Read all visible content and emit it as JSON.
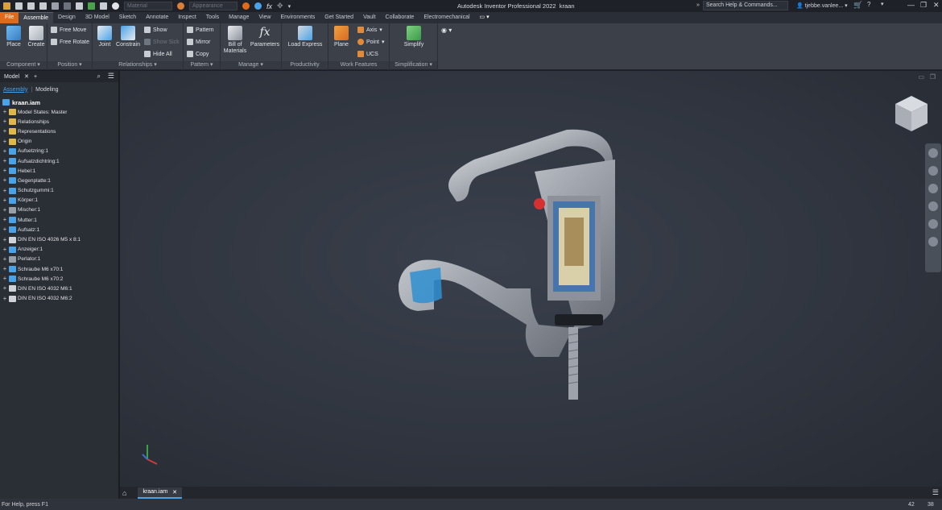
{
  "app": {
    "title": "Autodesk Inventor Professional 2022",
    "document": "kraan",
    "material_placeholder": "Material",
    "appearance_placeholder": "Appearance",
    "search_label": "Search Help & Commands...",
    "user": "tjebbe.vanlee..."
  },
  "tabs": [
    "File",
    "Assemble",
    "Design",
    "3D Model",
    "Sketch",
    "Annotate",
    "Inspect",
    "Tools",
    "Manage",
    "View",
    "Environments",
    "Get Started",
    "Vault",
    "Collaborate",
    "Electromechanical"
  ],
  "ribbon": {
    "component": {
      "label": "Component",
      "place": "Place",
      "create": "Create"
    },
    "position": {
      "label": "Position",
      "free_move": "Free Move",
      "free_rotate": "Free Rotate"
    },
    "relationships": {
      "label": "Relationships",
      "joint": "Joint",
      "constrain": "Constrain",
      "show": "Show",
      "show_sick": "Show Sick",
      "hide_all": "Hide All"
    },
    "pattern": {
      "label": "Pattern",
      "pattern": "Pattern",
      "mirror": "Mirror",
      "copy": "Copy"
    },
    "manage": {
      "label": "Manage",
      "bom": "Bill of Materials",
      "parameters": "Parameters"
    },
    "productivity": {
      "label": "Productivity",
      "load_express": "Load Express"
    },
    "work_features": {
      "label": "Work Features",
      "plane": "Plane",
      "axis": "Axis",
      "point": "Point",
      "ucs": "UCS"
    },
    "simplification": {
      "label": "Simplification",
      "simplify": "Simplify"
    }
  },
  "browser": {
    "tab": "Model",
    "subtabs": [
      "Assembly",
      "Modeling"
    ],
    "root": "kraan.iam",
    "items": [
      {
        "label": "Model States: Master",
        "icon": "folder-icon"
      },
      {
        "label": "Relationships",
        "icon": "folder-icon"
      },
      {
        "label": "Representations",
        "icon": "folder-icon"
      },
      {
        "label": "Origin",
        "icon": "folder-icon"
      },
      {
        "label": "Aufsetzring:1",
        "icon": "part-icon"
      },
      {
        "label": "Aufsatzdichtring:1",
        "icon": "part-icon"
      },
      {
        "label": "Hebel:1",
        "icon": "part-icon"
      },
      {
        "label": "Gegenplatte:1",
        "icon": "part-icon"
      },
      {
        "label": "Schutzgummi:1",
        "icon": "part-icon"
      },
      {
        "label": "Körper:1",
        "icon": "part-icon"
      },
      {
        "label": "Mischer:1",
        "icon": "subassembly-icon"
      },
      {
        "label": "Mutter:1",
        "icon": "part-icon"
      },
      {
        "label": "Aufsatz:1",
        "icon": "part-icon"
      },
      {
        "label": "DIN EN ISO 4026 M5 x 8:1",
        "icon": "fastener-icon"
      },
      {
        "label": "Anzeiger:1",
        "icon": "part-icon"
      },
      {
        "label": "Perlator:1",
        "icon": "subassembly-icon"
      },
      {
        "label": "Schraube M6 x70:1",
        "icon": "part-icon"
      },
      {
        "label": "Schraube M6 x70:2",
        "icon": "part-icon"
      },
      {
        "label": "DIN EN ISO 4032 M6:1",
        "icon": "fastener-icon"
      },
      {
        "label": "DIN EN ISO 4032 M6:2",
        "icon": "fastener-icon"
      }
    ]
  },
  "doc_tab": "kraan.iam",
  "status": {
    "help": "For Help, press F1",
    "count_a": "42",
    "count_b": "38"
  },
  "colors": {
    "accent": "#e06a1b",
    "link": "#4aa3e8"
  }
}
